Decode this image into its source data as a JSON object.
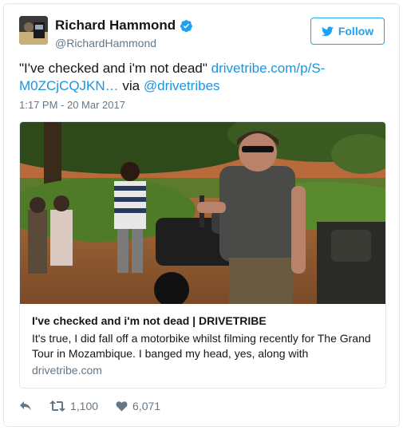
{
  "author": {
    "name": "Richard Hammond",
    "handle": "@RichardHammond",
    "verified": true
  },
  "follow_button": {
    "label": "Follow",
    "icon": "twitter-bird-icon"
  },
  "tweet": {
    "text_quote": "\"I've checked and i'm not dead\" ",
    "link_text": "drivetribe.com/p/S-M0ZCjCQJKN…",
    "via_text": " via ",
    "mention": "@drivetribes",
    "timestamp": "1:17 PM - 20 Mar 2017"
  },
  "card": {
    "title": "I've checked and i'm not dead | DRIVETRIBE",
    "description": "It's true, I did fall off a motorbike whilst filming recently for The Grand Tour in Mozambique. I banged my head, yes, along with",
    "domain": "drivetribe.com"
  },
  "actions": {
    "reply_icon": "reply-icon",
    "retweet_icon": "retweet-icon",
    "retweet_count": "1,100",
    "like_icon": "heart-icon",
    "like_count": "6,071"
  },
  "colors": {
    "accent": "#1da1f2",
    "link": "#1b95e0",
    "muted": "#657786",
    "border": "#e1e8ed"
  }
}
